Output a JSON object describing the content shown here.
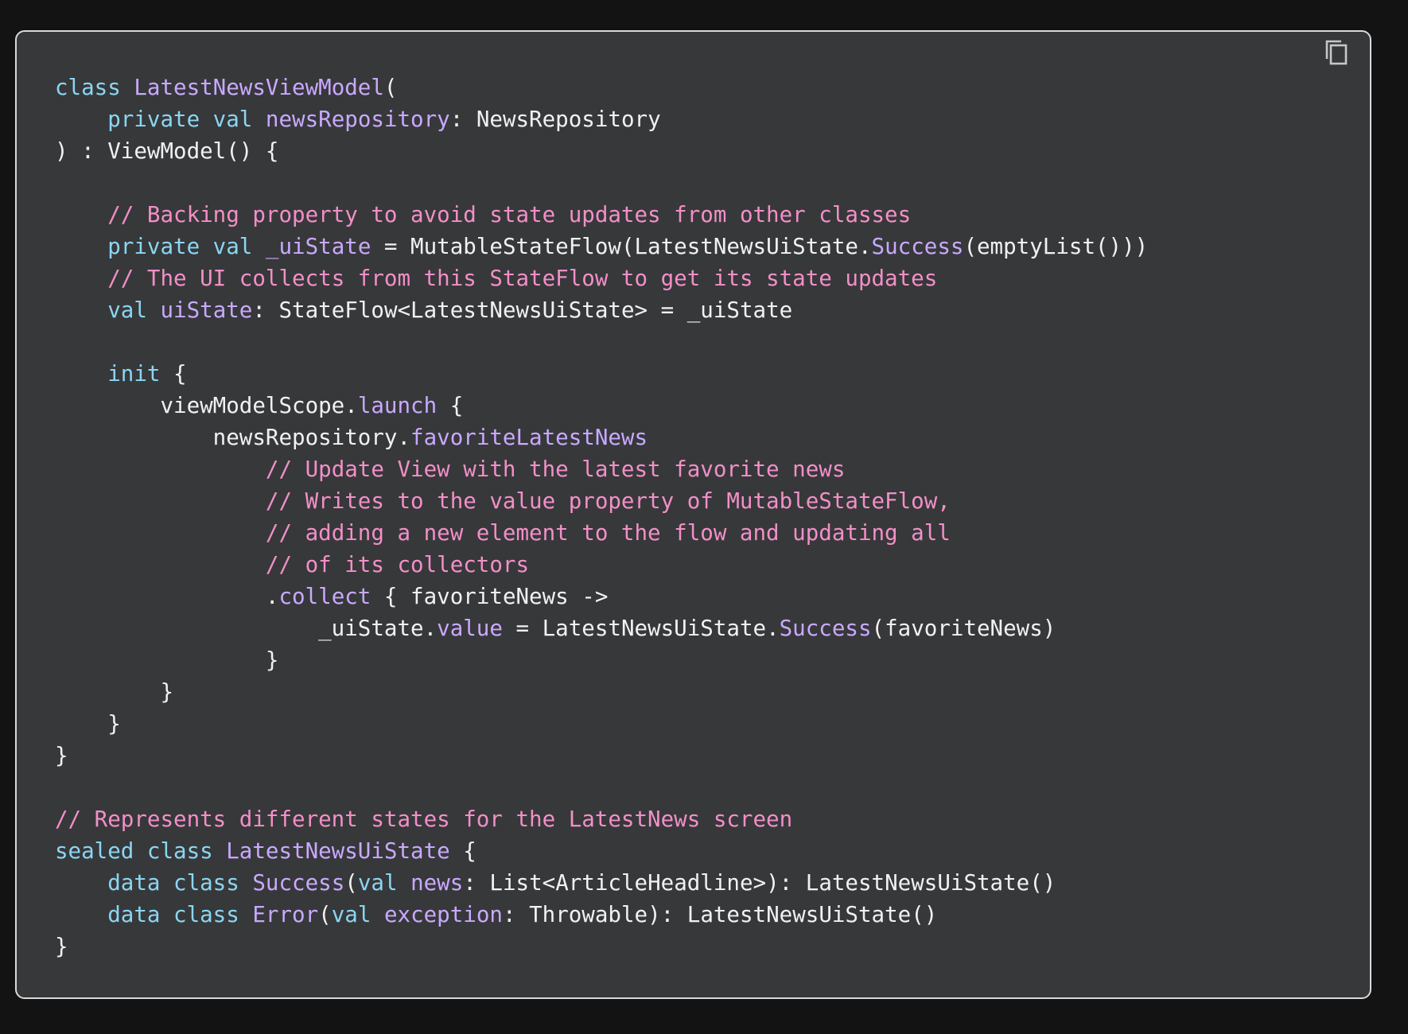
{
  "copy_button": {
    "icon": "copy-icon"
  },
  "colors": {
    "background": "#131314",
    "panel": "#37383a",
    "border": "#d8d9db",
    "keyword": "#8ad6f3",
    "type": "#c9a9ff",
    "comment": "#f28fc8",
    "text": "#f1f1f1"
  },
  "code_lines": [
    [
      [
        "kw",
        "class "
      ],
      [
        "ty",
        "LatestNewsViewModel"
      ],
      [
        "tx",
        "("
      ]
    ],
    [
      [
        "tx",
        "    "
      ],
      [
        "kw",
        "private val "
      ],
      [
        "pr",
        "newsRepository"
      ],
      [
        "tx",
        ": NewsRepository"
      ]
    ],
    [
      [
        "tx",
        ") : ViewModel() {"
      ]
    ],
    [],
    [
      [
        "tx",
        "    "
      ],
      [
        "cm",
        "// Backing property to avoid state updates from other classes"
      ]
    ],
    [
      [
        "tx",
        "    "
      ],
      [
        "kw",
        "private val "
      ],
      [
        "pr",
        "_uiState"
      ],
      [
        "tx",
        " = MutableStateFlow(LatestNewsUiState."
      ],
      [
        "pr",
        "Success"
      ],
      [
        "tx",
        "(emptyList()))"
      ]
    ],
    [
      [
        "tx",
        "    "
      ],
      [
        "cm",
        "// The UI collects from this StateFlow to get its state updates"
      ]
    ],
    [
      [
        "tx",
        "    "
      ],
      [
        "kw",
        "val "
      ],
      [
        "pr",
        "uiState"
      ],
      [
        "tx",
        ": StateFlow<LatestNewsUiState> = _uiState"
      ]
    ],
    [],
    [
      [
        "tx",
        "    "
      ],
      [
        "kw",
        "init"
      ],
      [
        "tx",
        " {"
      ]
    ],
    [
      [
        "tx",
        "        viewModelScope."
      ],
      [
        "pr",
        "launch"
      ],
      [
        "tx",
        " {"
      ]
    ],
    [
      [
        "tx",
        "            newsRepository."
      ],
      [
        "pr",
        "favoriteLatestNews"
      ]
    ],
    [
      [
        "tx",
        "                "
      ],
      [
        "cm",
        "// Update View with the latest favorite news"
      ]
    ],
    [
      [
        "tx",
        "                "
      ],
      [
        "cm",
        "// Writes to the value property of MutableStateFlow,"
      ]
    ],
    [
      [
        "tx",
        "                "
      ],
      [
        "cm",
        "// adding a new element to the flow and updating all"
      ]
    ],
    [
      [
        "tx",
        "                "
      ],
      [
        "cm",
        "// of its collectors"
      ]
    ],
    [
      [
        "tx",
        "                ."
      ],
      [
        "pr",
        "collect"
      ],
      [
        "tx",
        " { favoriteNews ->"
      ]
    ],
    [
      [
        "tx",
        "                    _uiState."
      ],
      [
        "pr",
        "value"
      ],
      [
        "tx",
        " = LatestNewsUiState."
      ],
      [
        "pr",
        "Success"
      ],
      [
        "tx",
        "(favoriteNews)"
      ]
    ],
    [
      [
        "tx",
        "                }"
      ]
    ],
    [
      [
        "tx",
        "        }"
      ]
    ],
    [
      [
        "tx",
        "    }"
      ]
    ],
    [
      [
        "tx",
        "}"
      ]
    ],
    [],
    [
      [
        "cm",
        "// Represents different states for the LatestNews screen"
      ]
    ],
    [
      [
        "kw",
        "sealed class "
      ],
      [
        "ty",
        "LatestNewsUiState"
      ],
      [
        "tx",
        " {"
      ]
    ],
    [
      [
        "tx",
        "    "
      ],
      [
        "kw",
        "data class "
      ],
      [
        "ty",
        "Success"
      ],
      [
        "tx",
        "("
      ],
      [
        "kw",
        "val "
      ],
      [
        "pr",
        "news"
      ],
      [
        "tx",
        ": List<ArticleHeadline>): LatestNewsUiState()"
      ]
    ],
    [
      [
        "tx",
        "    "
      ],
      [
        "kw",
        "data class "
      ],
      [
        "ty",
        "Error"
      ],
      [
        "tx",
        "("
      ],
      [
        "kw",
        "val "
      ],
      [
        "pr",
        "exception"
      ],
      [
        "tx",
        ": Throwable): LatestNewsUiState()"
      ]
    ],
    [
      [
        "tx",
        "}"
      ]
    ]
  ]
}
